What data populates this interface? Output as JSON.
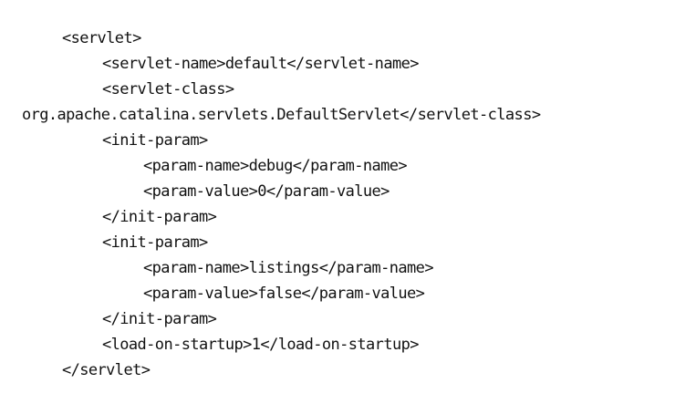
{
  "code": {
    "lines": [
      "<servlet>",
      "<servlet-name>default</servlet-name>",
      "<servlet-class>",
      "org.apache.catalina.servlets.DefaultServlet</servlet-class>",
      "<init-param>",
      "<param-name>debug</param-name>",
      "<param-value>0</param-value>",
      "</init-param>",
      "<init-param>",
      "<param-name>listings</param-name>",
      "<param-value>false</param-value>",
      "</init-param>",
      "<load-on-startup>1</load-on-startup>",
      "</servlet>"
    ]
  }
}
